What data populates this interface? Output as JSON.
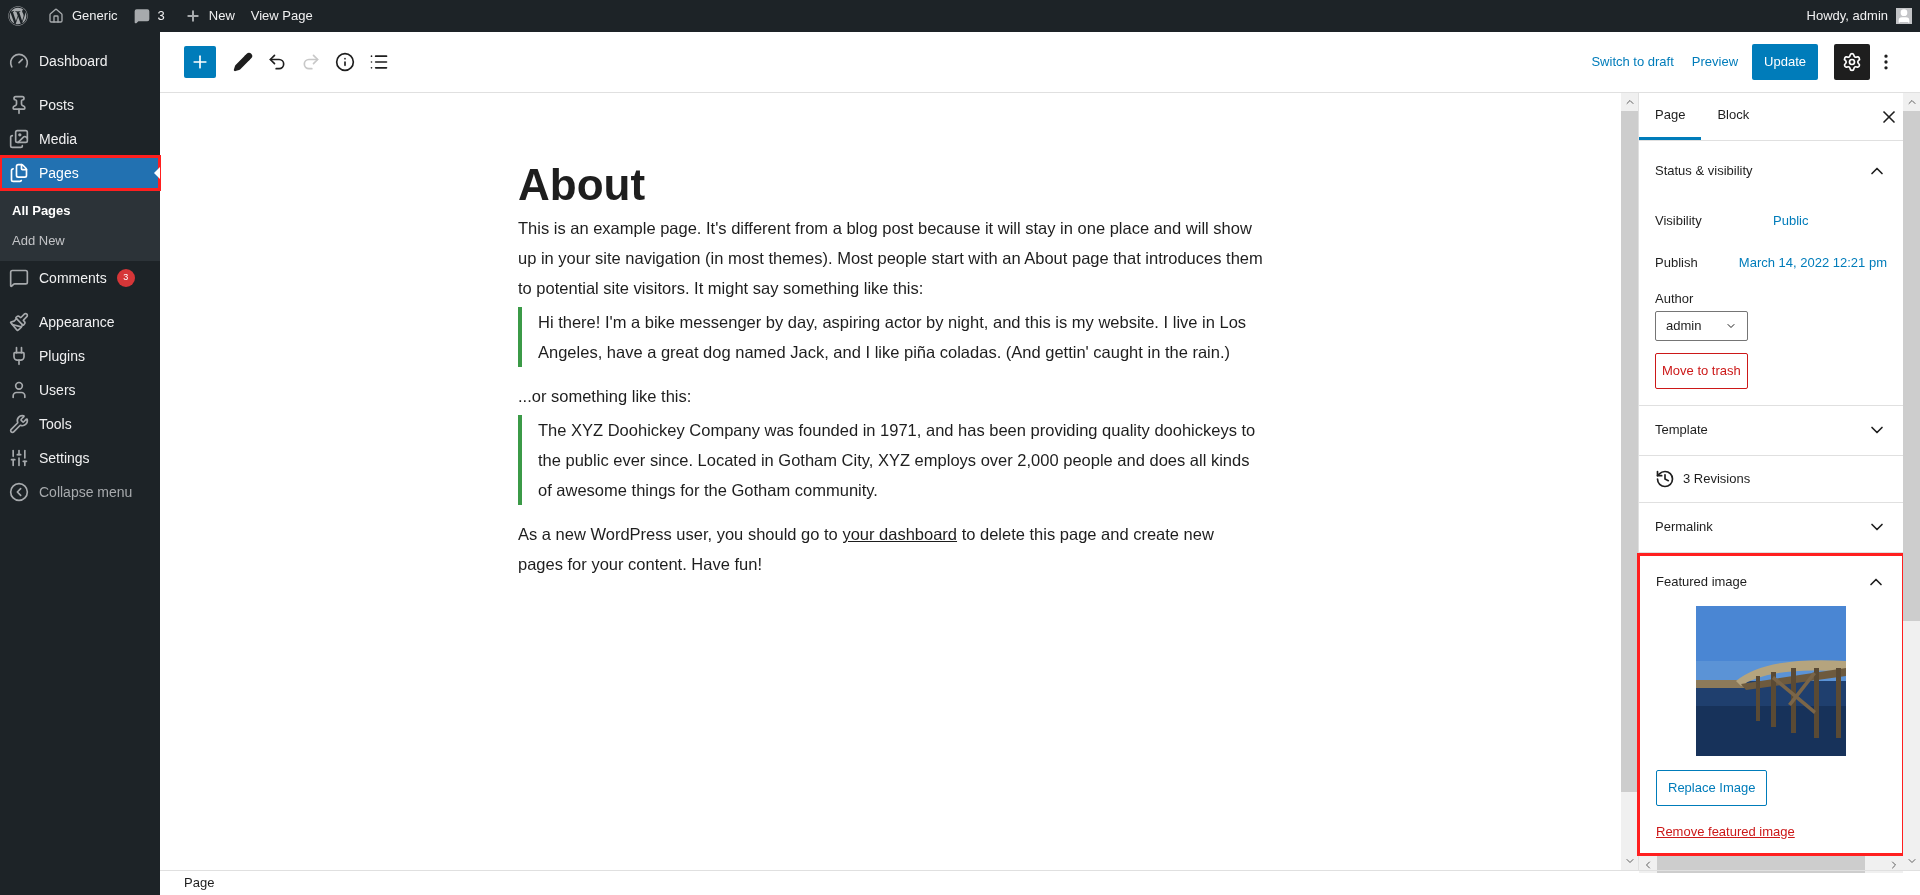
{
  "admin_bar": {
    "site": "Generic",
    "comments": "3",
    "new": "New",
    "view_page": "View Page",
    "greeting": "Howdy, admin"
  },
  "menu": [
    {
      "items": [
        {
          "label": "Dashboard",
          "selected": false
        }
      ]
    },
    {
      "items": [
        {
          "label": "Posts",
          "selected": false
        },
        {
          "label": "Media",
          "selected": false
        },
        {
          "label": "Pages",
          "selected": true,
          "highlighted": true,
          "submenu": [
            {
              "label": "All Pages",
              "selected": true
            },
            {
              "label": "Add New",
              "selected": false
            }
          ]
        },
        {
          "label": "Comments",
          "selected": false,
          "badge": "3"
        }
      ]
    },
    {
      "items": [
        {
          "label": "Appearance",
          "selected": false
        },
        {
          "label": "Plugins",
          "selected": false
        },
        {
          "label": "Users",
          "selected": false
        },
        {
          "label": "Tools",
          "selected": false
        },
        {
          "label": "Settings",
          "selected": false
        },
        {
          "label": "Collapse menu",
          "selected": false,
          "kind": "collapse"
        }
      ]
    }
  ],
  "toolbar": {
    "redo_disabled": true,
    "switch_to_draft": "Switch to draft",
    "preview": "Preview",
    "update": "Update",
    "settings_selected": true
  },
  "content": {
    "title": "About",
    "blocks": [
      {
        "kind": "paragraph",
        "text": "This is an example page. It's different from a blog post because it will stay in one place and will show up in your site navigation (in most themes). Most people start with an About page that introduces them to potential site visitors. It might say something like this:"
      },
      {
        "kind": "quote",
        "text": "Hi there! I'm a bike messenger by day, aspiring actor by night, and this is my website. I live in Los Angeles, have a great dog named Jack, and I like piña coladas. (And gettin' caught in the rain.)"
      },
      {
        "kind": "paragraph",
        "text": "...or something like this:"
      },
      {
        "kind": "quote",
        "text": "The XYZ Doohickey Company was founded in 1971, and has been providing quality doohickeys to the public ever since. Located in Gotham City, XYZ employs over 2,000 people and does all kinds of awesome things for the Gotham community."
      },
      {
        "kind": "link_paragraph",
        "before": "As a new WordPress user, you should go to ",
        "link": "your dashboard",
        "after": " to delete this page and create new pages for your content. Have fun!"
      }
    ]
  },
  "panel": {
    "tabs": [
      {
        "label": "Page",
        "selected": true
      },
      {
        "label": "Block",
        "selected": false
      }
    ],
    "status": {
      "title": "Status & visibility",
      "expanded": true,
      "visibility_label": "Visibility",
      "visibility": "Public",
      "publish_label": "Publish",
      "publish": "March 14, 2022 12:21 pm",
      "author_label": "Author",
      "author": "admin",
      "trash": "Move to trash"
    },
    "template": {
      "title": "Template",
      "expanded": false
    },
    "revisions": "3 Revisions",
    "permalink": {
      "title": "Permalink",
      "expanded": false
    },
    "featured": {
      "title": "Featured image",
      "expanded": true,
      "highlighted": true,
      "replace": "Replace Image",
      "remove": "Remove featured image"
    }
  },
  "footer": {
    "breadcrumb": "Page"
  }
}
